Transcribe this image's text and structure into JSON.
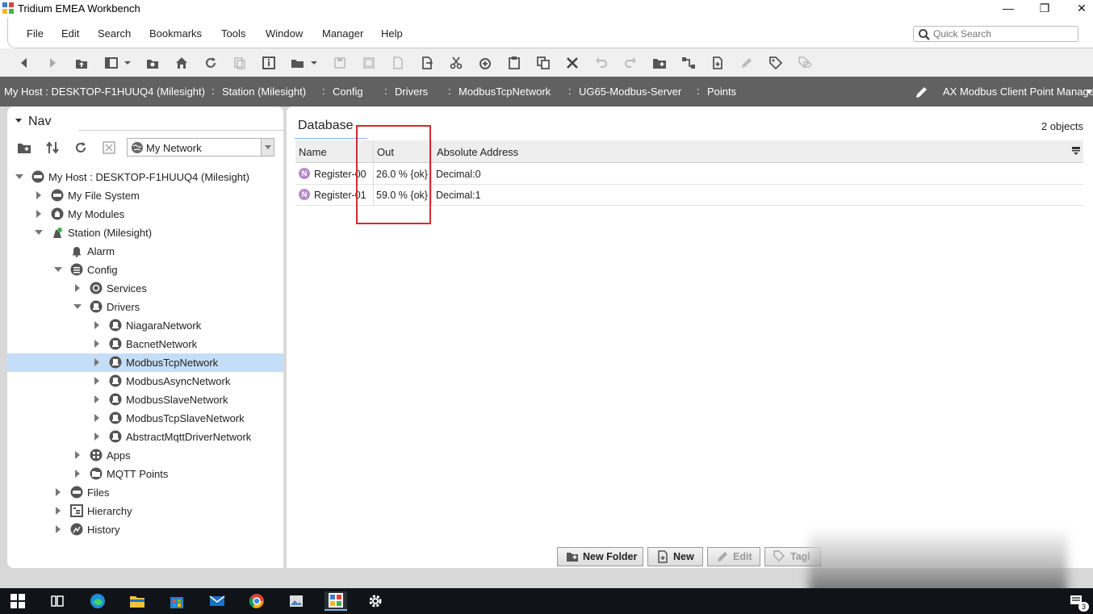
{
  "window": {
    "title": "Tridium EMEA Workbench",
    "minimize_glyph": "—",
    "restore_glyph": "❐",
    "close_glyph": "✕"
  },
  "menu": {
    "items": [
      "File",
      "Edit",
      "Search",
      "Bookmarks",
      "Tools",
      "Window",
      "Manager",
      "Help"
    ],
    "quick_search_placeholder": "Quick Search"
  },
  "toolbar": {
    "icons": [
      "back-icon",
      "forward-icon",
      "up-level-icon",
      "side-bar-icon",
      "refresh-folder-icon",
      "home-icon",
      "refresh-icon",
      "copy-disabled-icon",
      "info-icon",
      "open-folder-icon",
      "save-icon",
      "save-all-icon",
      "find-icon",
      "export-icon",
      "cut-icon",
      "copy-icon",
      "paste-icon",
      "duplicate-icon",
      "delete-icon",
      "undo-icon",
      "redo-icon",
      "new-folder-icon",
      "link-icon",
      "new-icon",
      "edit-icon",
      "tag-icon",
      "tag-it-icon"
    ]
  },
  "breadcrumb": {
    "items": [
      "My Host : DESKTOP-F1HUUQ4 (Milesight)",
      "Station (Milesight)",
      "Config",
      "Drivers",
      "ModbusTcpNetwork",
      "UG65-Modbus-Server",
      "Points"
    ],
    "view_name": "AX Modbus Client Point Manager"
  },
  "nav": {
    "tab_label": "Nav",
    "network_select": "My Network",
    "tree": [
      {
        "label": "My Host : DESKTOP-F1HUUQ4 (Milesight)",
        "state": "expanded",
        "icon": "host-icon"
      },
      {
        "label": "My File System",
        "state": "collapsed",
        "icon": "drive-icon"
      },
      {
        "label": "My Modules",
        "state": "collapsed",
        "icon": "modules-icon"
      },
      {
        "label": "Station (Milesight)",
        "state": "expanded",
        "icon": "station-icon"
      },
      {
        "label": "Alarm",
        "state": "none",
        "icon": "bell-icon"
      },
      {
        "label": "Config",
        "state": "expanded",
        "icon": "config-icon"
      },
      {
        "label": "Services",
        "state": "collapsed",
        "icon": "services-icon"
      },
      {
        "label": "Drivers",
        "state": "expanded",
        "icon": "driver-icon"
      },
      {
        "label": "NiagaraNetwork",
        "state": "collapsed",
        "icon": "network-icon"
      },
      {
        "label": "BacnetNetwork",
        "state": "collapsed",
        "icon": "network-icon"
      },
      {
        "label": "ModbusTcpNetwork",
        "state": "collapsed",
        "icon": "network-icon",
        "selected": true
      },
      {
        "label": "ModbusAsyncNetwork",
        "state": "collapsed",
        "icon": "network-icon"
      },
      {
        "label": "ModbusSlaveNetwork",
        "state": "collapsed",
        "icon": "network-icon"
      },
      {
        "label": "ModbusTcpSlaveNetwork",
        "state": "collapsed",
        "icon": "network-icon"
      },
      {
        "label": "AbstractMqttDriverNetwork",
        "state": "collapsed",
        "icon": "network-icon"
      },
      {
        "label": "Apps",
        "state": "collapsed",
        "icon": "apps-icon"
      },
      {
        "label": "MQTT Points",
        "state": "collapsed",
        "icon": "folder-icon"
      },
      {
        "label": "Files",
        "state": "collapsed",
        "icon": "files-icon"
      },
      {
        "label": "Hierarchy",
        "state": "collapsed",
        "icon": "hierarchy-icon"
      },
      {
        "label": "History",
        "state": "collapsed",
        "icon": "history-icon"
      }
    ]
  },
  "database": {
    "tab_label": "Database",
    "object_count": "2 objects",
    "columns": [
      "Name",
      "Out",
      "Absolute Address"
    ],
    "rows": [
      {
        "badge": "N",
        "name": "Register-00",
        "out": "26.0 % {ok}",
        "address": "Decimal:0"
      },
      {
        "badge": "N",
        "name": "Register-01",
        "out": "59.0 % {ok}",
        "address": "Decimal:1"
      }
    ],
    "highlight_color": "#d42b2b"
  },
  "buttons": {
    "new_folder": "New Folder",
    "new": "New",
    "edit": "Edit",
    "tag": "Tagl"
  },
  "taskbar": {
    "apps": [
      "windows-start-icon",
      "task-view-icon",
      "edge-icon",
      "file-explorer-icon",
      "store-icon",
      "mail-icon",
      "chrome-icon",
      "photos-icon",
      "workbench-icon",
      "settings-icon"
    ],
    "notification_count": "3"
  },
  "colors": {
    "breadcrumb_bg": "#616161",
    "selection": "#c5def8",
    "badge": "#b88cc7"
  }
}
